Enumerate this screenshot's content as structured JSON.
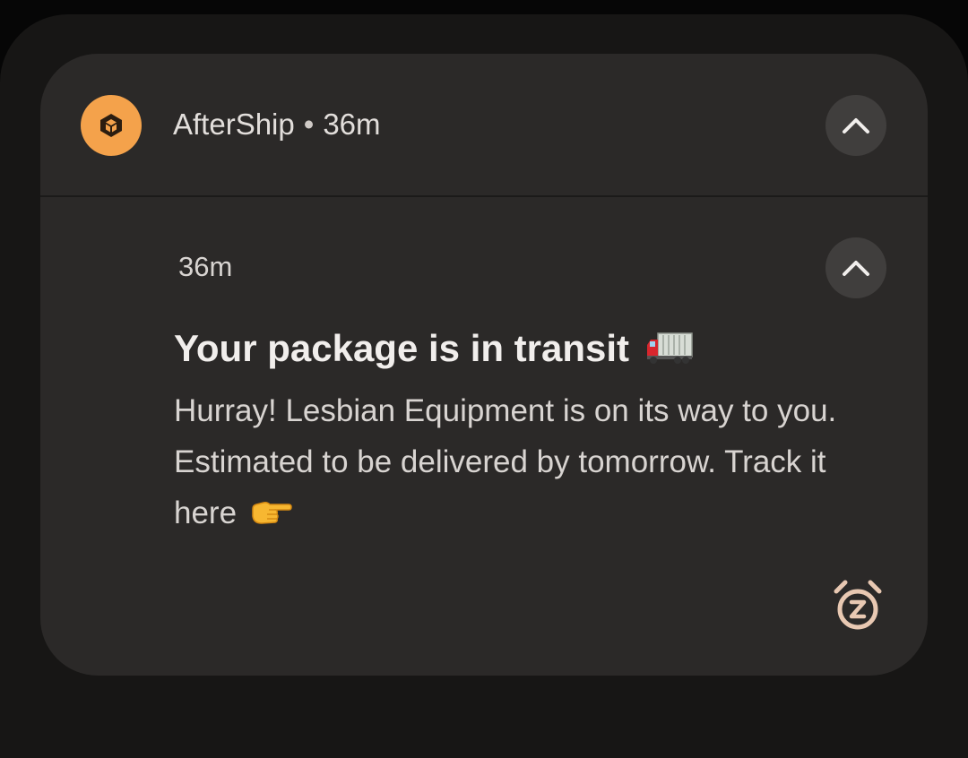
{
  "notification": {
    "app_name": "AfterShip",
    "separator": "•",
    "group_time": "36m",
    "message_time": "36m",
    "title": "Your package is in transit",
    "body": "Hurray! Lesbian Equipment is on its way to you. Estimated to be delivered by tomorrow. Track it here",
    "title_emoji": "truck-icon",
    "body_emoji": "pointing-right-icon"
  },
  "colors": {
    "app_icon": "#f4a24b",
    "card_background": "#2b2928",
    "title_text": "#f1eeec",
    "body_text": "#d8d4d1"
  }
}
